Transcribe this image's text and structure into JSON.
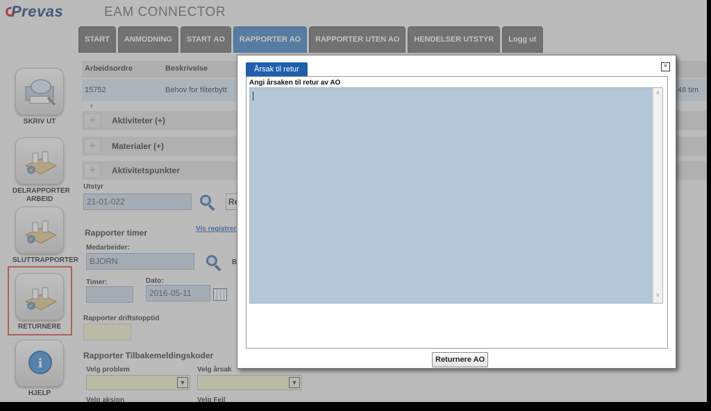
{
  "header": {
    "brand": "Prevas",
    "title": "EAM CONNECTOR"
  },
  "nav": [
    "START",
    "ANMODNING",
    "START AO",
    "RAPPORTER AO",
    "RAPPORTER UTEN AO",
    "HENDELSER UTSTYR",
    "Logg ut"
  ],
  "nav_active": "RAPPORTER AO",
  "sidebar": {
    "print": "SKRIV UT",
    "partial_line1": "DELRAPPORTER",
    "partial_line2": "ARBEID",
    "final": "SLUTTRAPPORTER",
    "return": "RETURNERE",
    "help": "HJELP"
  },
  "grid": {
    "col_order": "Arbeidsordre",
    "col_desc": "Beskrivelse",
    "row_order": "15752",
    "row_desc": "Behov for filterbytt",
    "row_tail": "48 tim"
  },
  "sections": {
    "activities": "Aktiviteter (+)",
    "materials": "Materialer (+)",
    "activity_points": "Aktivitetspunkter"
  },
  "equipment": {
    "label": "Utstyr",
    "value": "21-01-022",
    "button": "Re"
  },
  "hours": {
    "title": "Rapporter timer",
    "link": "Vis registrert",
    "employee_label": "Medarbeider:",
    "employee_value": "BJORN",
    "employee_tail": "B",
    "hours_label": "Timer:",
    "date_label": "Dato:",
    "date_value": "2016-05-11"
  },
  "downtime": {
    "label": "Rapporter driftstopptid"
  },
  "feedback": {
    "title": "Rapporter Tilbakemeldingskoder",
    "problem_label": "Velg problem",
    "cause_label": "Velg årsak",
    "action_label": "Velg aksjon",
    "fault_label": "Velg Feil"
  },
  "modal": {
    "tab": "Årsak til retur",
    "close": "×",
    "prompt": "Angi årsaken til retur av AO",
    "text_value": "",
    "submit": "Returnere AO"
  },
  "icons": {
    "print": "print-icon",
    "partial": "partial-report-icon",
    "final": "final-report-icon",
    "return": "return-icon",
    "help": "help-icon",
    "search": "magnifier-icon",
    "calendar": "calendar-icon"
  },
  "colors": {
    "nav": "#6d6d6d",
    "nav_active": "#3f7fc4",
    "modal_tab": "#1f5fae",
    "highlight": "#e04a3a"
  }
}
